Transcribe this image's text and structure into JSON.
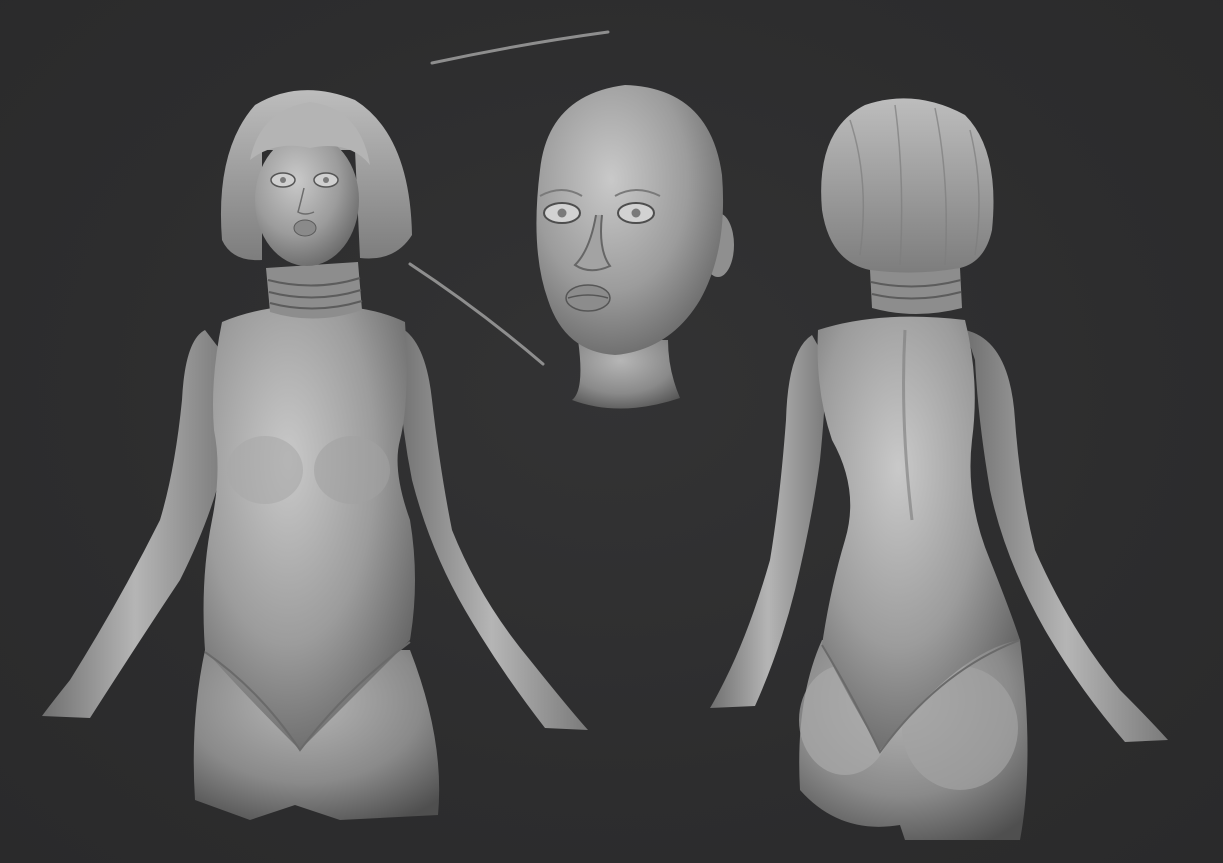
{
  "scene": {
    "background_color": "#2e2e2f",
    "clay_color": "#9a9a9a",
    "views": [
      "front-figure",
      "head-closeup",
      "back-figure"
    ]
  }
}
